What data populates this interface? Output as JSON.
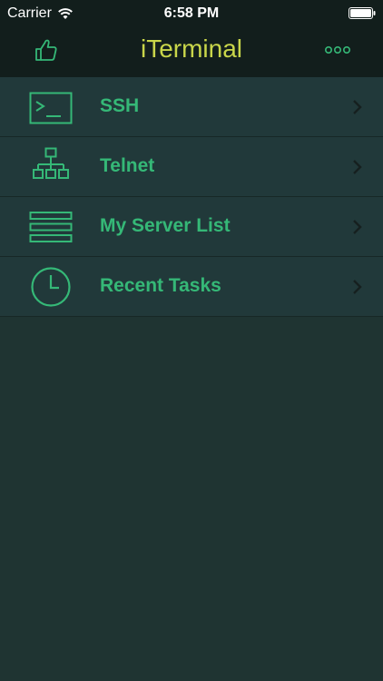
{
  "status_bar": {
    "carrier": "Carrier",
    "time": "6:58 PM",
    "wifi_icon": "wifi-icon",
    "battery_icon": "battery-icon"
  },
  "navbar": {
    "title": "iTerminal",
    "left_icon": "thumbs-up-icon",
    "right_icon": "more-icon"
  },
  "menu": {
    "items": [
      {
        "label": "SSH",
        "icon": "terminal-icon"
      },
      {
        "label": "Telnet",
        "icon": "network-icon"
      },
      {
        "label": "My Server List",
        "icon": "server-list-icon"
      },
      {
        "label": "Recent Tasks",
        "icon": "clock-icon"
      }
    ]
  },
  "colors": {
    "title": "#c9d64a",
    "accent": "#35b877",
    "background": "#1f3432",
    "bar": "#121e1c"
  }
}
